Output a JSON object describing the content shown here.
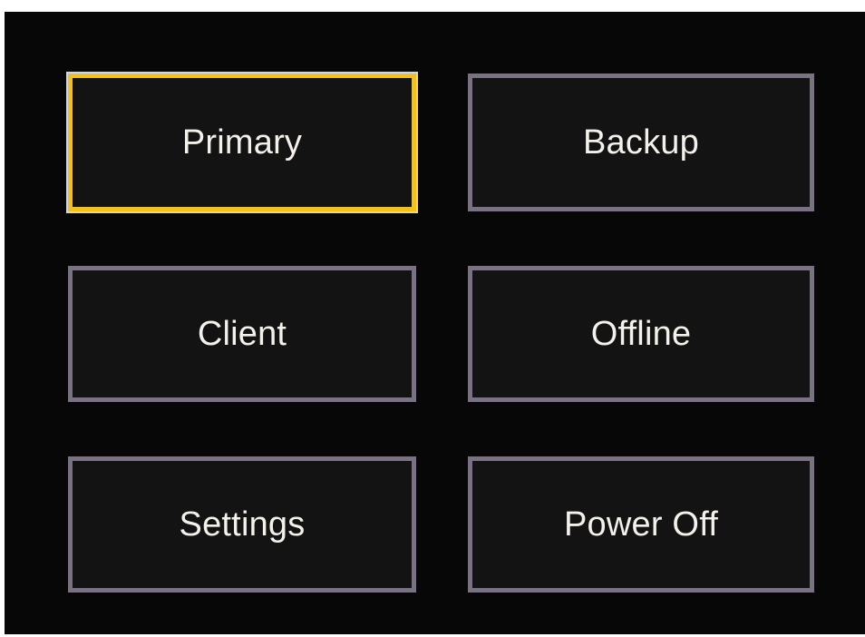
{
  "menu": {
    "buttons": [
      {
        "label": "Primary",
        "selected": true
      },
      {
        "label": "Backup",
        "selected": false
      },
      {
        "label": "Client",
        "selected": false
      },
      {
        "label": "Offline",
        "selected": false
      },
      {
        "label": "Settings",
        "selected": false
      },
      {
        "label": "Power Off",
        "selected": false
      }
    ]
  },
  "colors": {
    "background": "#070707",
    "button_fill": "#131313",
    "button_border": "#7a7282",
    "selected_border": "#f2c21b",
    "label_text": "#f4f0ea"
  }
}
